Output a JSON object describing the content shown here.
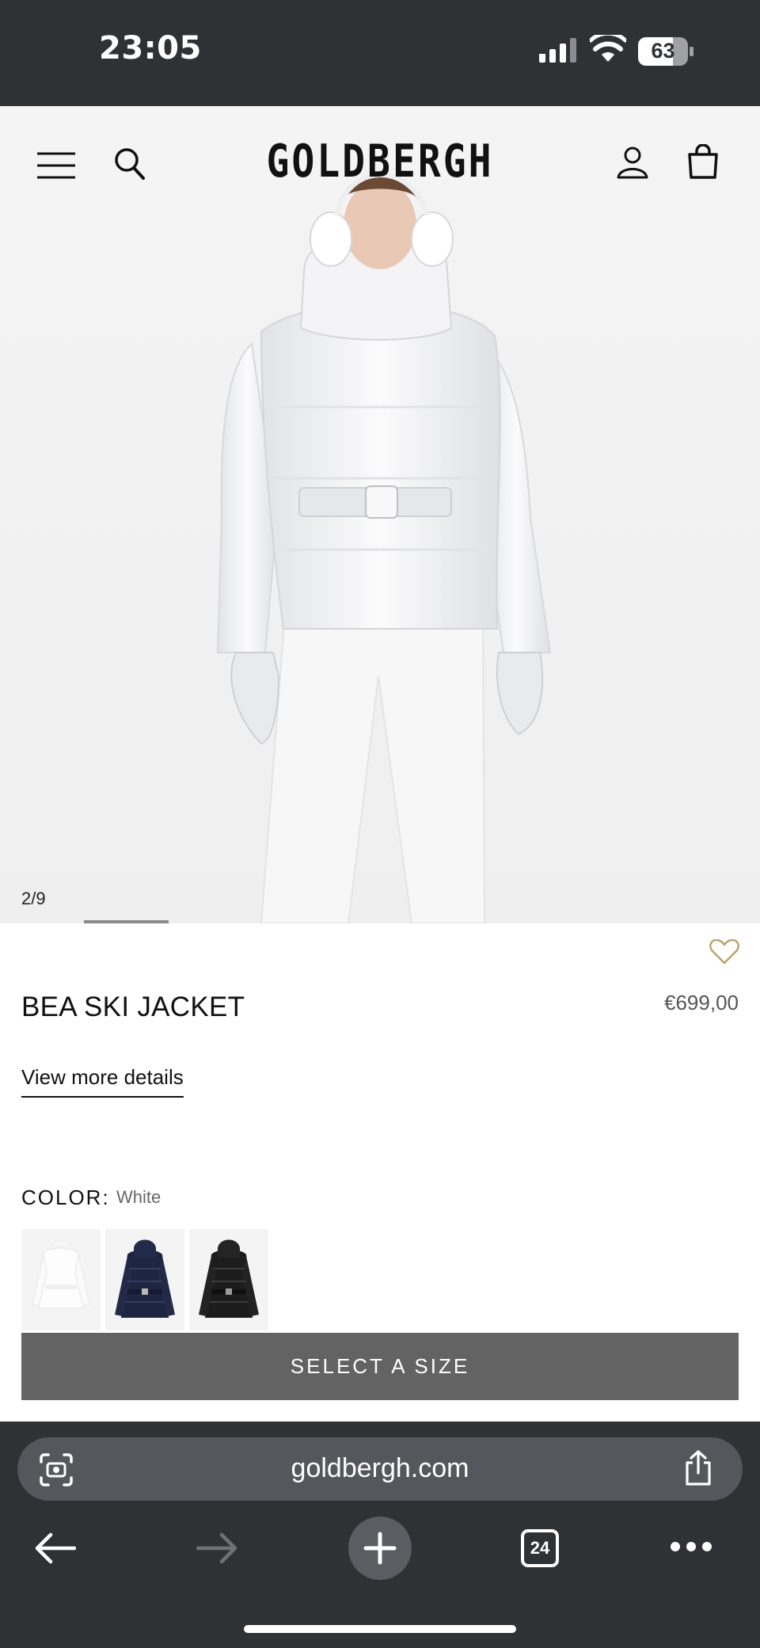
{
  "status_bar": {
    "time": "23:05",
    "battery": "63"
  },
  "site": {
    "logo": "GOLDBERGH"
  },
  "gallery": {
    "counter": "2/9",
    "progress": {
      "current": 2,
      "total": 9
    }
  },
  "product": {
    "name": "BEA SKI JACKET",
    "price": "€699,00",
    "details_link": "View more details",
    "color_label": "COLOR:",
    "color_value": "White",
    "swatches": [
      "White",
      "Navy",
      "Black"
    ],
    "select_size_label": "SELECT A SIZE"
  },
  "browser": {
    "url": "goldbergh.com",
    "tab_count": "24"
  },
  "colors": {
    "bar_bg": "#2f3235",
    "url_bg": "#54575b",
    "button_bg": "#636363",
    "heart": "#b9a36a"
  }
}
